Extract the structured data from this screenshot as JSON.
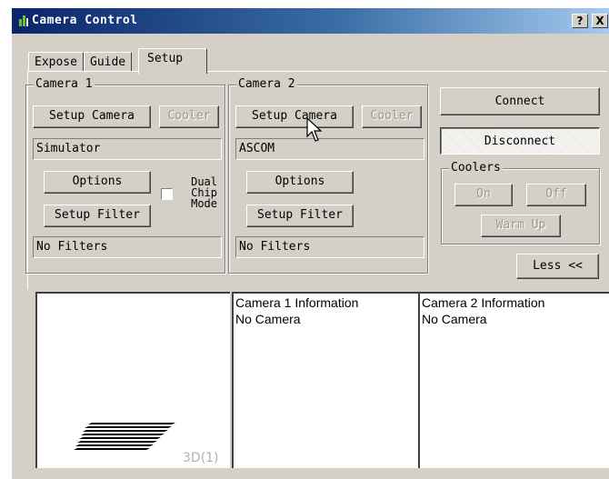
{
  "window": {
    "title": "Camera Control",
    "help_button": "?",
    "close_button": "X"
  },
  "tabs": [
    {
      "label": "Expose",
      "active": false
    },
    {
      "label": "Guide",
      "active": false
    },
    {
      "label": "Setup",
      "active": true
    }
  ],
  "camera1": {
    "label": "Camera 1",
    "setup_camera": "Setup Camera",
    "cooler": "Cooler",
    "camera_name": "Simulator",
    "options": "Options",
    "dual_chip_mode": [
      "Dual",
      "Chip",
      "Mode"
    ],
    "dual_chip_checked": false,
    "setup_filter": "Setup Filter",
    "filter_name": "No Filters"
  },
  "camera2": {
    "label": "Camera 2",
    "setup_camera": "Setup Camera",
    "cooler": "Cooler",
    "camera_name": "ASCOM",
    "options": "Options",
    "setup_filter": "Setup Filter",
    "filter_name": "No Filters"
  },
  "controls": {
    "connect": "Connect",
    "disconnect": "Disconnect",
    "coolers_label": "Coolers",
    "on": "On",
    "off": "Off",
    "warm_up": "Warm Up",
    "less": "Less <<"
  },
  "image_view": {
    "label": "3D(1)"
  },
  "info": {
    "camera1": {
      "title": "Camera 1 Information",
      "status": "No Camera"
    },
    "camera2": {
      "title": "Camera 2 Information",
      "status": "No Camera"
    }
  },
  "colors": {
    "face": "#d4d0c8",
    "title_start": "#0a246a",
    "title_end": "#a6caf0",
    "disabled_text": "#9a978f"
  }
}
